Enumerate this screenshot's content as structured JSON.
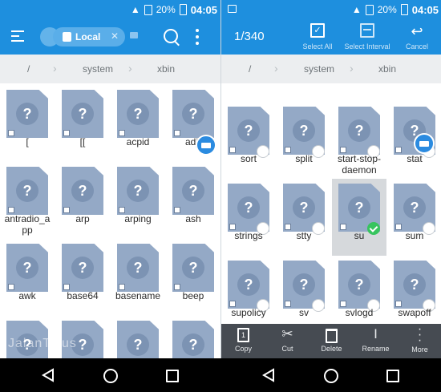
{
  "status_bar": {
    "battery": "20%",
    "time": "04:05"
  },
  "left_pane": {
    "tab_label": "Local",
    "breadcrumb": [
      "/",
      "system",
      "xbin"
    ],
    "files": [
      {
        "name": "["
      },
      {
        "name": "[["
      },
      {
        "name": "acpid"
      },
      {
        "name": "adjtimex",
        "label": "adjti"
      },
      {
        "name": "antradio_app",
        "line1": "antradio_a",
        "line2": "pp"
      },
      {
        "name": "arp"
      },
      {
        "name": "arping"
      },
      {
        "name": "ash"
      },
      {
        "name": "awk"
      },
      {
        "name": "base64"
      },
      {
        "name": "basename"
      },
      {
        "name": "beep"
      }
    ],
    "watermark": "JalanTikus"
  },
  "right_pane": {
    "selection_count": "1/340",
    "actions": {
      "select_all": "Select All",
      "select_interval": "Select Interval",
      "cancel": "Cancel"
    },
    "breadcrumb": [
      "/",
      "system",
      "xbin"
    ],
    "files": [
      {
        "name": "sort",
        "selected": false
      },
      {
        "name": "split",
        "selected": false
      },
      {
        "name": "start-stop-daemon",
        "line1": "start-stop-",
        "line2": "daemon",
        "selected": false
      },
      {
        "name": "stat",
        "selected": false
      },
      {
        "name": "strings",
        "selected": false
      },
      {
        "name": "stty",
        "selected": false
      },
      {
        "name": "su",
        "selected": true
      },
      {
        "name": "sum",
        "selected": false
      },
      {
        "name": "supolicy",
        "selected": false
      },
      {
        "name": "sv",
        "selected": false
      },
      {
        "name": "svlogd",
        "selected": false
      },
      {
        "name": "swapoff",
        "selected": false
      }
    ],
    "bottom_actions": {
      "copy": "Copy",
      "cut": "Cut",
      "delete": "Delete",
      "rename": "Rename",
      "more": "More"
    }
  },
  "colors": {
    "appbar": "#1e8fde",
    "file_icon": "#94a9c6",
    "selected_check": "#37c45e",
    "bottom_bar": "#464b52"
  }
}
